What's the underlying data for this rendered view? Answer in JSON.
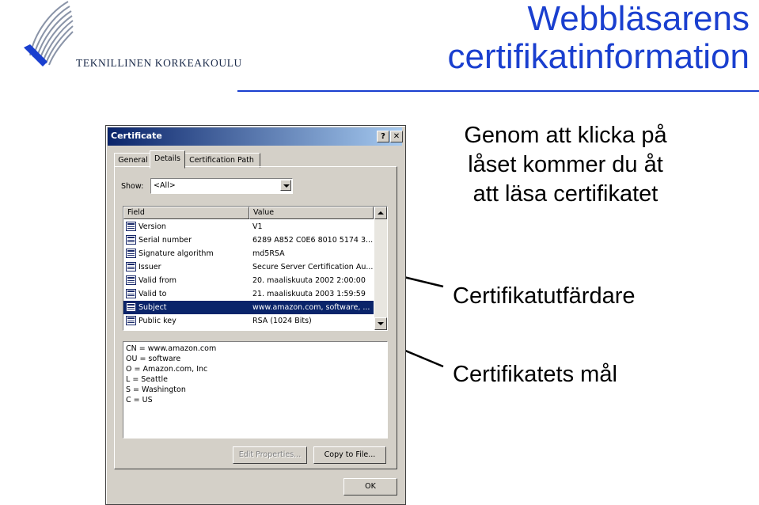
{
  "slide": {
    "logo_text": "TEKNILLINEN KORKEAKOULU",
    "title_line1": "Webbläsarens",
    "title_line2": "certifikatinformation",
    "note_main_line1": "Genom att klicka på",
    "note_main_line2": "låset kommer du åt",
    "note_main_line3": "att läsa certifikatet",
    "note_issuer": "Certifikatutfärdare",
    "note_subject": "Certifikatets mål",
    "accent_color": "#1a3fcf"
  },
  "dialog": {
    "title": "Certificate",
    "help_label": "?",
    "close_label": "✕",
    "tabs": [
      {
        "label": "General",
        "active": false
      },
      {
        "label": "Details",
        "active": true
      },
      {
        "label": "Certification Path",
        "active": false
      }
    ],
    "show_label": "Show:",
    "show_value": "<All>",
    "columns": {
      "field": "Field",
      "value": "Value"
    },
    "rows": [
      {
        "field": "Version",
        "value": "V1"
      },
      {
        "field": "Serial number",
        "value": "6289 A852 C0E6 8010 5174 3..."
      },
      {
        "field": "Signature algorithm",
        "value": "md5RSA"
      },
      {
        "field": "Issuer",
        "value": "Secure Server Certification Au..."
      },
      {
        "field": "Valid from",
        "value": "20. maaliskuuta 2002 2:00:00"
      },
      {
        "field": "Valid to",
        "value": "21. maaliskuuta 2003 1:59:59"
      },
      {
        "field": "Subject",
        "value": "www.amazon.com, software, ...",
        "selected": true
      },
      {
        "field": "Public key",
        "value": "RSA (1024 Bits)"
      }
    ],
    "detail_lines": [
      "CN = www.amazon.com",
      "OU = software",
      "O = Amazon.com, Inc",
      "L = Seattle",
      "S = Washington",
      "C = US"
    ],
    "edit_properties_label": "Edit Properties...",
    "copy_to_file_label": "Copy to File...",
    "ok_label": "OK"
  }
}
